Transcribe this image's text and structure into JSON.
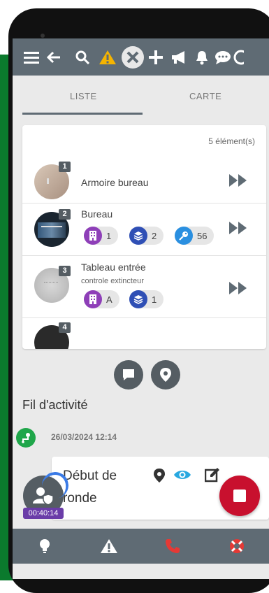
{
  "tabs": {
    "list_label": "LISTE",
    "map_label": "CARTE"
  },
  "list": {
    "count": "5 élément(s)",
    "items": [
      {
        "number": "1",
        "title": "Armoire bureau",
        "subtitle": "",
        "chips": []
      },
      {
        "number": "2",
        "title": "Bureau",
        "subtitle": "",
        "chips": [
          {
            "icon": "building-icon",
            "value": "1",
            "color": "#8e3fb8"
          },
          {
            "icon": "layers-icon",
            "value": "2",
            "color": "#2f4fb5"
          },
          {
            "icon": "key-icon",
            "value": "56",
            "color": "#2a8fe0"
          }
        ]
      },
      {
        "number": "3",
        "title": "Tableau entrée",
        "subtitle": "controle extincteur",
        "chips": [
          {
            "icon": "building-icon",
            "value": "A",
            "color": "#8e3fb8"
          },
          {
            "icon": "layers-icon",
            "value": "1",
            "color": "#2f4fb5"
          }
        ]
      },
      {
        "number": "4",
        "title": "",
        "subtitle": "",
        "chips": []
      }
    ]
  },
  "feed": {
    "title": "Fil d'activité",
    "date": "26/03/2024 12:14",
    "card_title": "Début de ronde"
  },
  "timer": "00:40:14",
  "colors": {
    "toolbar": "#5f6b74",
    "warning": "#f5b400",
    "stop": "#c8102e",
    "phone_red": "#e53935"
  }
}
